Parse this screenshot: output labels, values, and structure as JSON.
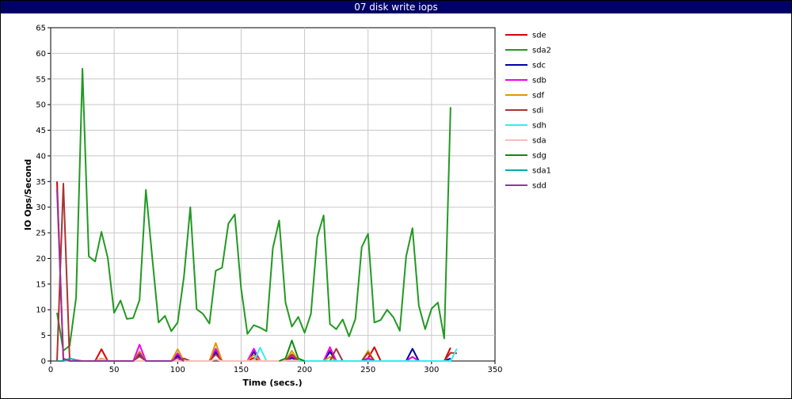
{
  "chart_data": {
    "type": "line",
    "title": "07 disk write iops",
    "xlabel": "Time (secs.)",
    "ylabel": "IO Ops/Second",
    "xlim": [
      0,
      350
    ],
    "ylim": [
      0,
      65
    ],
    "xticks": [
      0,
      50,
      100,
      150,
      200,
      250,
      300,
      350
    ],
    "yticks": [
      0,
      5,
      10,
      15,
      20,
      25,
      30,
      35,
      40,
      45,
      50,
      55,
      60,
      65
    ],
    "grid": true,
    "legend_position": "right",
    "series": [
      {
        "name": "sde",
        "color": "#dd0000",
        "x": [
          5,
          10,
          15,
          20,
          25,
          30,
          35,
          40,
          45,
          50,
          55,
          60,
          65,
          70,
          75,
          80,
          85,
          90,
          95,
          100,
          105,
          110,
          115,
          120,
          125,
          130,
          135,
          140,
          145,
          150,
          155,
          160,
          165,
          170,
          175,
          180,
          185,
          190,
          195,
          200,
          205,
          210,
          215,
          220,
          225,
          230,
          235,
          240,
          245,
          250,
          255,
          260,
          265,
          270,
          275,
          280,
          285,
          290,
          295,
          300,
          305,
          310,
          315
        ],
        "y": [
          35,
          0,
          0,
          0,
          0,
          0,
          0,
          2.3,
          0,
          0,
          0,
          0,
          0,
          1.2,
          0,
          0,
          0,
          0,
          0,
          0.8,
          0,
          0,
          0,
          0,
          0,
          1.5,
          0,
          0,
          0,
          0,
          0,
          0.6,
          0,
          0,
          0,
          0,
          0,
          1.0,
          0,
          0,
          0,
          0,
          0,
          2.0,
          0,
          0,
          0,
          0,
          0,
          0.5,
          2.7,
          0,
          0,
          0,
          0,
          0,
          0.8,
          0,
          0,
          0,
          0,
          0,
          2.6
        ]
      },
      {
        "name": "sda2",
        "color": "#229922",
        "x": [
          5,
          10,
          15,
          20,
          25,
          30,
          35,
          40,
          45,
          50,
          55,
          60,
          65,
          70,
          75,
          80,
          85,
          90,
          95,
          100,
          105,
          110,
          115,
          120,
          125,
          130,
          135,
          140,
          145,
          150,
          155,
          160,
          165,
          170,
          175,
          180,
          185,
          190,
          195,
          200,
          205,
          210,
          215,
          220,
          225,
          230,
          235,
          240,
          245,
          250,
          255,
          260,
          265,
          270,
          275,
          280,
          285,
          290,
          295,
          300,
          305,
          310,
          315
        ],
        "y": [
          9.4,
          2.0,
          3.0,
          12.4,
          57.0,
          20.4,
          19.4,
          25.2,
          20.1,
          9.4,
          11.8,
          8.2,
          8.4,
          11.9,
          33.4,
          20.2,
          7.5,
          8.8,
          5.8,
          7.5,
          16.5,
          30.0,
          10.1,
          9.2,
          7.3,
          17.6,
          18.2,
          26.8,
          28.6,
          14.2,
          5.3,
          7.0,
          6.5,
          5.8,
          22.0,
          27.4,
          11.4,
          6.7,
          8.6,
          5.5,
          9.2,
          24.2,
          28.4,
          7.2,
          6.2,
          8.1,
          4.8,
          8.2,
          22.2,
          24.8,
          7.5,
          8.0,
          10.0,
          8.5,
          5.9,
          20.4,
          25.9,
          10.8,
          6.2,
          10.2,
          11.4,
          4.4,
          49.5
        ]
      },
      {
        "name": "sdc",
        "color": "#0000aa",
        "x": [
          5,
          15,
          20,
          35,
          40,
          45,
          65,
          70,
          75,
          95,
          100,
          105,
          125,
          130,
          135,
          155,
          160,
          165,
          185,
          190,
          195,
          215,
          220,
          225,
          245,
          250,
          255,
          280,
          285,
          290,
          310,
          315
        ],
        "y": [
          0,
          0,
          0,
          0,
          0.4,
          0,
          0,
          1.0,
          0,
          0,
          1.1,
          0,
          0,
          1.8,
          0,
          0,
          1.8,
          0,
          0,
          0.6,
          0,
          0,
          1.8,
          0,
          0,
          0.5,
          0,
          0,
          2.4,
          0,
          0,
          0.5
        ]
      },
      {
        "name": "sdb",
        "color": "#ee00ee",
        "x": [
          5,
          15,
          20,
          35,
          40,
          45,
          65,
          70,
          75,
          95,
          100,
          105,
          125,
          130,
          135,
          155,
          160,
          165,
          185,
          190,
          195,
          215,
          220,
          225,
          245,
          250,
          255,
          280,
          285,
          290
        ],
        "y": [
          0,
          0,
          0,
          0,
          0.3,
          0,
          0,
          3.2,
          0,
          0,
          1.5,
          0,
          0,
          2.4,
          0,
          0,
          2.4,
          0,
          0,
          1.0,
          0,
          0,
          2.7,
          0,
          0,
          0.6,
          0,
          0,
          0.8,
          0
        ]
      },
      {
        "name": "sdf",
        "color": "#dd9900",
        "x": [
          5,
          15,
          20,
          35,
          40,
          45,
          65,
          70,
          75,
          95,
          100,
          105,
          125,
          130,
          135,
          155,
          160,
          165,
          185,
          190,
          195,
          215,
          220,
          225,
          245,
          250,
          255
        ],
        "y": [
          0,
          0,
          0,
          0,
          0.5,
          0,
          0,
          1.9,
          0,
          0,
          2.3,
          0,
          0,
          3.5,
          0,
          0,
          1.2,
          0,
          0,
          2.0,
          0,
          0,
          0.8,
          0,
          0,
          2.0,
          0
        ]
      },
      {
        "name": "sdi",
        "color": "#aa3333",
        "x": [
          5,
          10,
          15,
          20,
          60,
          65,
          70,
          75,
          100,
          105,
          110,
          125,
          130,
          135,
          185,
          190,
          195,
          220,
          225,
          230,
          245,
          250,
          255,
          305,
          310,
          315,
          320
        ],
        "y": [
          0,
          34.6,
          0,
          0,
          0,
          0,
          0.9,
          0,
          0,
          0.5,
          0,
          0,
          1.3,
          0,
          0,
          1.3,
          0,
          0,
          2.4,
          0,
          0,
          1.6,
          0,
          0,
          0,
          1.6,
          1.5
        ]
      },
      {
        "name": "sdh",
        "color": "#33eeee",
        "x": [
          160,
          165,
          170,
          310,
          315,
          320
        ],
        "y": [
          0,
          2.6,
          0,
          0,
          0,
          2.4
        ]
      },
      {
        "name": "sda",
        "color": "#ffbbbb",
        "x": [
          5,
          15,
          35,
          40,
          45,
          125,
          130,
          135,
          185,
          190,
          195
        ],
        "y": [
          0,
          0,
          0,
          0.3,
          0,
          0,
          0.3,
          0,
          0,
          0.2,
          0
        ]
      },
      {
        "name": "sdg",
        "color": "#118811",
        "x": [
          180,
          185,
          190,
          195,
          200
        ],
        "y": [
          0,
          0.5,
          4.0,
          0.5,
          0
        ]
      },
      {
        "name": "sda1",
        "color": "#00aaaa",
        "x": [
          5,
          10,
          15,
          20,
          25
        ],
        "y": [
          0,
          0,
          0.5,
          0.2,
          0
        ]
      },
      {
        "name": "sdd",
        "color": "#993399",
        "x": [
          5,
          10,
          15,
          20,
          65,
          70,
          75,
          95,
          100,
          105
        ],
        "y": [
          33.5,
          0.5,
          0,
          0,
          0,
          1.5,
          0,
          0,
          0.6,
          0
        ]
      }
    ]
  }
}
